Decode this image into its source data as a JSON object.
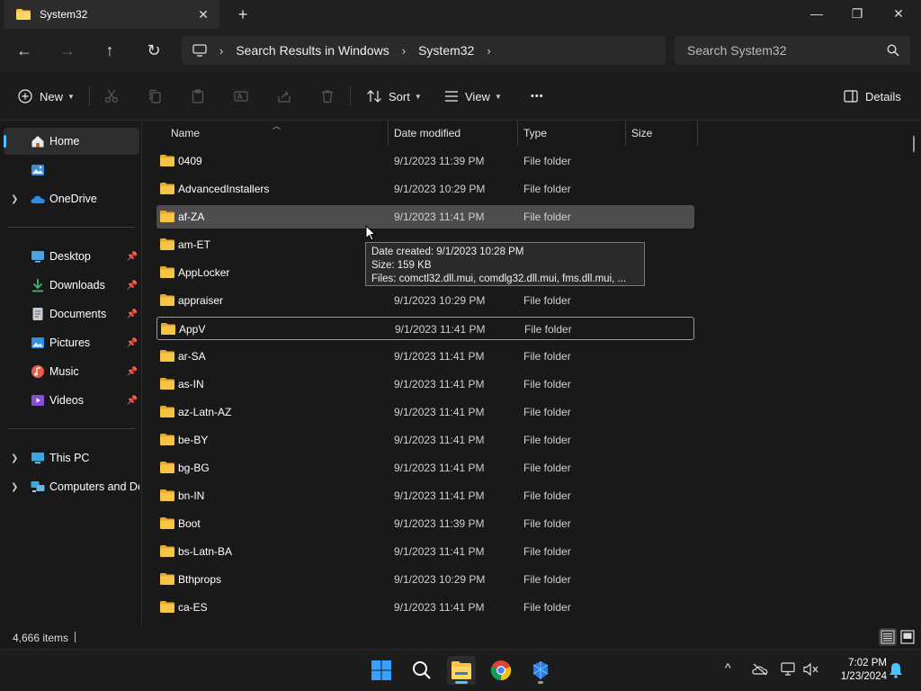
{
  "window": {
    "tab_title": "System32",
    "tab_close": "✕",
    "new_tab": "+",
    "minimize": "—",
    "maximize": "❐",
    "close": "✕"
  },
  "nav": {
    "back": "←",
    "forward": "→",
    "up": "↑",
    "refresh": "↻"
  },
  "address": {
    "crumbs": [
      "Search Results in Windows",
      "System32"
    ],
    "separator": "›"
  },
  "search": {
    "placeholder": "Search System32"
  },
  "commands": {
    "new_label": "New",
    "sort_label": "Sort",
    "view_label": "View",
    "more": "•••",
    "details_label": "Details"
  },
  "sidebar": {
    "items": [
      {
        "label": "Home",
        "icon": "home-icon"
      },
      {
        "label": "",
        "icon": "gallery-icon"
      },
      {
        "label": "OneDrive",
        "icon": "onedrive-icon"
      },
      {
        "label": "Desktop",
        "icon": "desktop-icon"
      },
      {
        "label": "Downloads",
        "icon": "downloads-icon"
      },
      {
        "label": "Documents",
        "icon": "documents-icon"
      },
      {
        "label": "Pictures",
        "icon": "pictures-icon"
      },
      {
        "label": "Music",
        "icon": "music-icon"
      },
      {
        "label": "Videos",
        "icon": "videos-icon"
      },
      {
        "label": "This PC",
        "icon": "this-pc-icon"
      },
      {
        "label": "Computers and Devices",
        "icon": "network-icon"
      }
    ]
  },
  "columns": {
    "name": "Name",
    "date": "Date modified",
    "type": "Type",
    "size": "Size"
  },
  "files": [
    {
      "name": "0409",
      "date": "9/1/2023 11:39 PM",
      "type": "File folder"
    },
    {
      "name": "AdvancedInstallers",
      "date": "9/1/2023 10:29 PM",
      "type": "File folder"
    },
    {
      "name": "af-ZA",
      "date": "9/1/2023 11:41 PM",
      "type": "File folder"
    },
    {
      "name": "am-ET",
      "date": "",
      "type": ""
    },
    {
      "name": "AppLocker",
      "date": "",
      "type": ""
    },
    {
      "name": "appraiser",
      "date": "9/1/2023 10:29 PM",
      "type": "File folder"
    },
    {
      "name": "AppV",
      "date": "9/1/2023 11:41 PM",
      "type": "File folder"
    },
    {
      "name": "ar-SA",
      "date": "9/1/2023 11:41 PM",
      "type": "File folder"
    },
    {
      "name": "as-IN",
      "date": "9/1/2023 11:41 PM",
      "type": "File folder"
    },
    {
      "name": "az-Latn-AZ",
      "date": "9/1/2023 11:41 PM",
      "type": "File folder"
    },
    {
      "name": "be-BY",
      "date": "9/1/2023 11:41 PM",
      "type": "File folder"
    },
    {
      "name": "bg-BG",
      "date": "9/1/2023 11:41 PM",
      "type": "File folder"
    },
    {
      "name": "bn-IN",
      "date": "9/1/2023 11:41 PM",
      "type": "File folder"
    },
    {
      "name": "Boot",
      "date": "9/1/2023 11:39 PM",
      "type": "File folder"
    },
    {
      "name": "bs-Latn-BA",
      "date": "9/1/2023 11:41 PM",
      "type": "File folder"
    },
    {
      "name": "Bthprops",
      "date": "9/1/2023 10:29 PM",
      "type": "File folder"
    },
    {
      "name": "ca-ES",
      "date": "9/1/2023 11:41 PM",
      "type": "File folder"
    }
  ],
  "tooltip": {
    "line1": "Date created: 9/1/2023 10:28 PM",
    "line2": "Size: 159 KB",
    "line3": "Files: comctl32.dll.mui, comdlg32.dll.mui, fms.dll.mui, ..."
  },
  "status": {
    "item_count": "4,666 items"
  },
  "clock": {
    "time": "7:02 PM",
    "date": "1/23/2024"
  },
  "tray": {
    "overflow": "^"
  },
  "colors": {
    "accent": "#4cc2ff",
    "folder": "#f8c443",
    "background": "#191919"
  }
}
